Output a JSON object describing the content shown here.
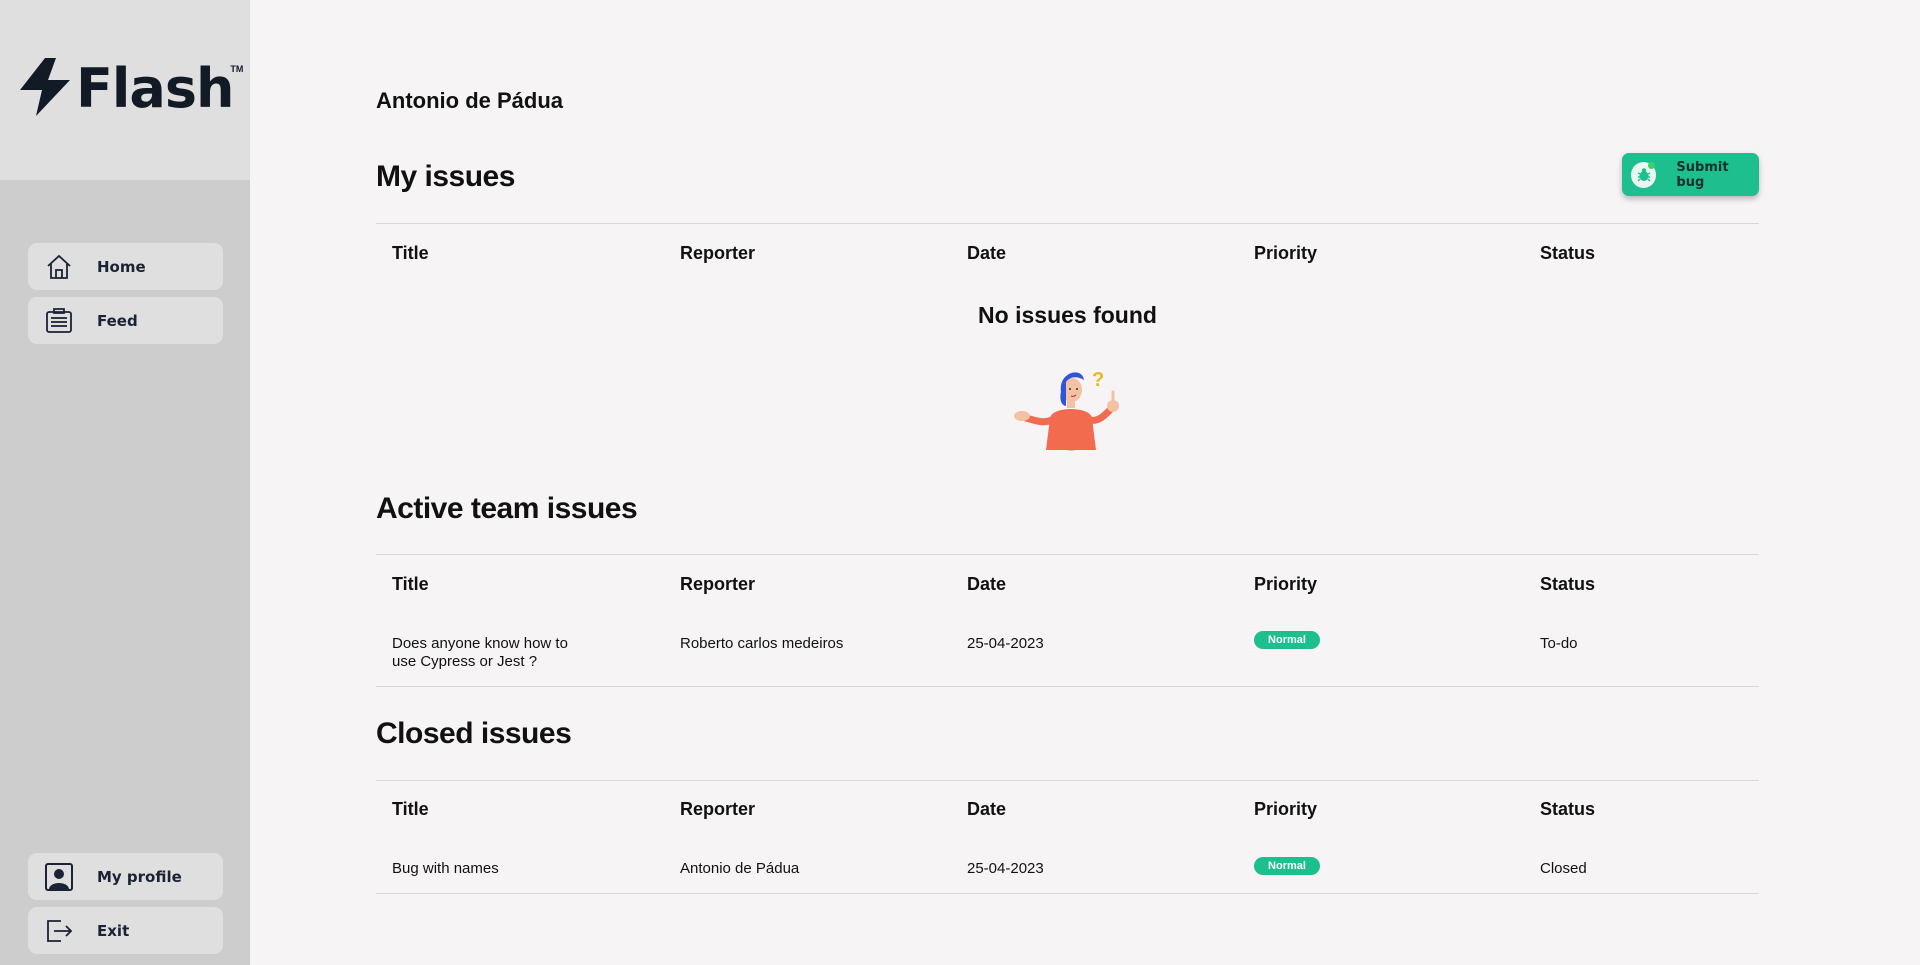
{
  "brand": {
    "name": "Flash",
    "trademark": "TM"
  },
  "sidebar": {
    "top_items": [
      {
        "label": "Home",
        "icon": "home-icon"
      },
      {
        "label": "Feed",
        "icon": "feed-icon"
      }
    ],
    "bottom_items": [
      {
        "label": "My profile",
        "icon": "profile-icon"
      },
      {
        "label": "Exit",
        "icon": "exit-icon"
      }
    ]
  },
  "user": {
    "name": "Antonio de Pádua"
  },
  "submit_bug": {
    "label": "Submit bug",
    "icon": "bug-icon"
  },
  "columns": [
    "Title",
    "Reporter",
    "Date",
    "Priority",
    "Status"
  ],
  "sections": {
    "my_issues": {
      "title": "My issues",
      "empty_text": "No issues found",
      "rows": []
    },
    "active_team_issues": {
      "title": "Active team issues",
      "rows": [
        {
          "title": "Does anyone know how to use Cypress or Jest ?",
          "reporter": "Roberto carlos medeiros",
          "date": "25-04-2023",
          "priority": "Normal",
          "status": "To-do"
        }
      ]
    },
    "closed_issues": {
      "title": "Closed issues",
      "rows": [
        {
          "title": "Bug with names",
          "reporter": "Antonio de Pádua",
          "date": "25-04-2023",
          "priority": "Normal",
          "status": "Closed"
        }
      ]
    }
  },
  "colors": {
    "accent": "#1dbf8e",
    "sidebar_bg": "#cdcdcd",
    "sidebar_panel": "#dfdfe0",
    "page_bg": "#f6f4f4",
    "brand_dark": "#121a26"
  }
}
